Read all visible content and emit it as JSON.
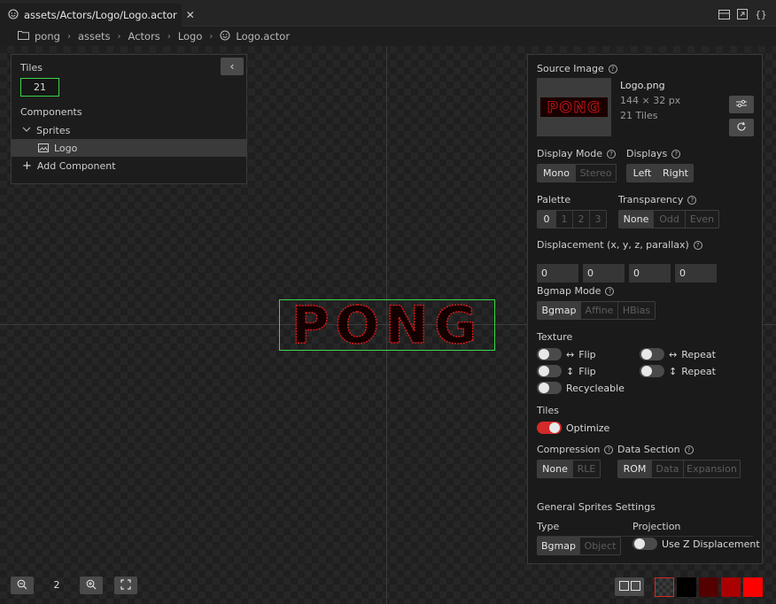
{
  "tab": {
    "title": "assets/Actors/Logo/Logo.actor"
  },
  "breadcrumb": [
    "pong",
    "assets",
    "Actors",
    "Logo",
    "Logo.actor"
  ],
  "sprite": {
    "text": "PONG"
  },
  "left_panel": {
    "tiles_label": "Tiles",
    "tiles_value": "21",
    "components_label": "Components",
    "sprites_label": "Sprites",
    "logo_label": "Logo",
    "add_component": "Add Component"
  },
  "right_panel": {
    "source_image": {
      "label": "Source Image",
      "filename": "Logo.png",
      "dimensions": "144 × 32 px",
      "tiles": "21 Tiles",
      "thumb_text": "PONG"
    },
    "display_mode": {
      "label": "Display Mode",
      "options": [
        "Mono",
        "Stereo"
      ],
      "selected": "Mono"
    },
    "displays": {
      "label": "Displays",
      "options": [
        "Left",
        "Right"
      ]
    },
    "palette": {
      "label": "Palette",
      "options": [
        "0",
        "1",
        "2",
        "3"
      ],
      "selected": "0"
    },
    "transparency": {
      "label": "Transparency",
      "options": [
        "None",
        "Odd",
        "Even"
      ],
      "selected": "None"
    },
    "displacement": {
      "label": "Displacement (x, y, z, parallax)",
      "values": [
        "0",
        "0",
        "0",
        "0"
      ]
    },
    "bgmap_mode": {
      "label": "Bgmap Mode",
      "options": [
        "Bgmap",
        "Affine",
        "HBias"
      ],
      "selected": "Bgmap"
    },
    "texture": {
      "label": "Texture",
      "flip_h": "Flip",
      "flip_v": "Flip",
      "repeat_h": "Repeat",
      "repeat_v": "Repeat",
      "recycleable": "Recycleable"
    },
    "tiles": {
      "label": "Tiles",
      "optimize": "Optimize",
      "optimize_on": true
    },
    "compression": {
      "label": "Compression",
      "options": [
        "None",
        "RLE"
      ],
      "selected": "None"
    },
    "data_section": {
      "label": "Data Section",
      "options": [
        "ROM",
        "Data",
        "Expansion"
      ],
      "selected": "ROM"
    },
    "general": {
      "heading": "General Sprites Settings",
      "type_label": "Type",
      "type_options": [
        "Bgmap",
        "Object"
      ],
      "type_selected": "Bgmap",
      "projection_label": "Projection",
      "use_z": "Use Z Displacement"
    }
  },
  "zoom": {
    "value": "2"
  },
  "colors": {
    "accent_green": "#3bd64a",
    "toggle_on": "#d32a2a",
    "palette_swatches": [
      "#000000",
      "#550000",
      "#aa0000",
      "#ff0000"
    ]
  }
}
